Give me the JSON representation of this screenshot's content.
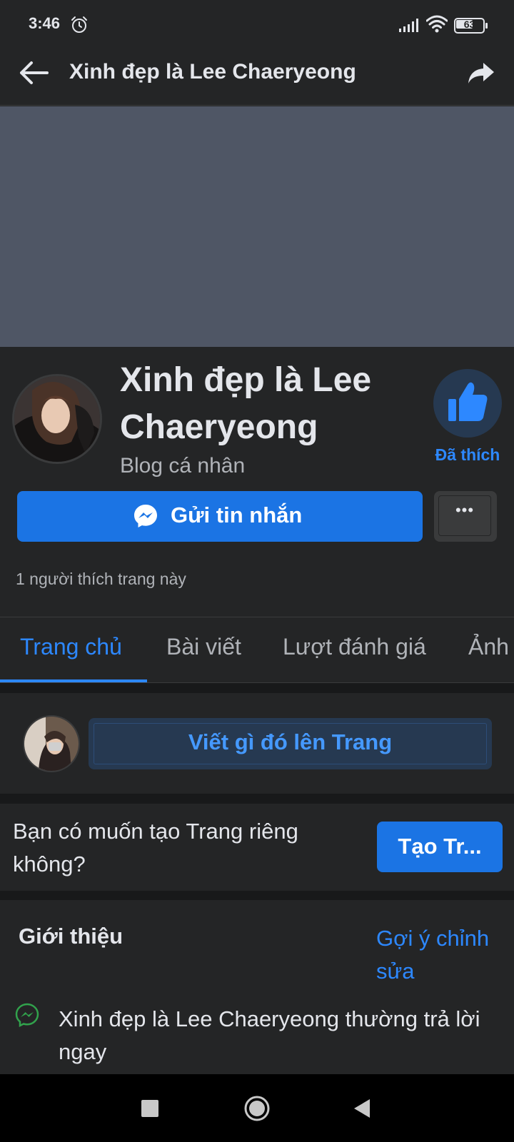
{
  "status_bar": {
    "time": "3:46",
    "battery": "63",
    "battery_level": 0.63,
    "icons": [
      "alarm-icon",
      "signal-icon",
      "wifi-icon",
      "battery-icon"
    ]
  },
  "header": {
    "title": "Xinh đẹp là Lee Chaeryeong",
    "back_icon": "arrow-left-icon",
    "share_icon": "share-icon"
  },
  "profile": {
    "name": "Xinh đẹp là Lee Chaeryeong",
    "category": "Blog cá nhân",
    "like_status": "Đã thích",
    "like_icon": "thumbs-up-icon",
    "message_button": "Gửi tin nhắn",
    "more_button": "•••",
    "likes_text": "1 người thích trang này"
  },
  "tabs": [
    {
      "label": "Trang chủ",
      "active": true
    },
    {
      "label": "Bài viết",
      "active": false
    },
    {
      "label": "Lượt đánh giá",
      "active": false
    },
    {
      "label": "Ảnh",
      "active": false
    }
  ],
  "composer": {
    "placeholder": "Viết gì đó lên Trang"
  },
  "create_page": {
    "text": "Bạn có muốn tạo Trang riêng không?",
    "button": "Tạo Tr..."
  },
  "intro": {
    "title": "Giới thiệu",
    "suggest_edit": "Gợi ý chỉnh sửa",
    "response_text": "Xinh đẹp là Lee Chaeryeong thường trả lời ngay"
  },
  "colors": {
    "background": "#242526",
    "accent": "#2d88ff",
    "button_blue": "#1b74e4",
    "cover": "#4f5665",
    "messenger_green": "#31a24c"
  }
}
